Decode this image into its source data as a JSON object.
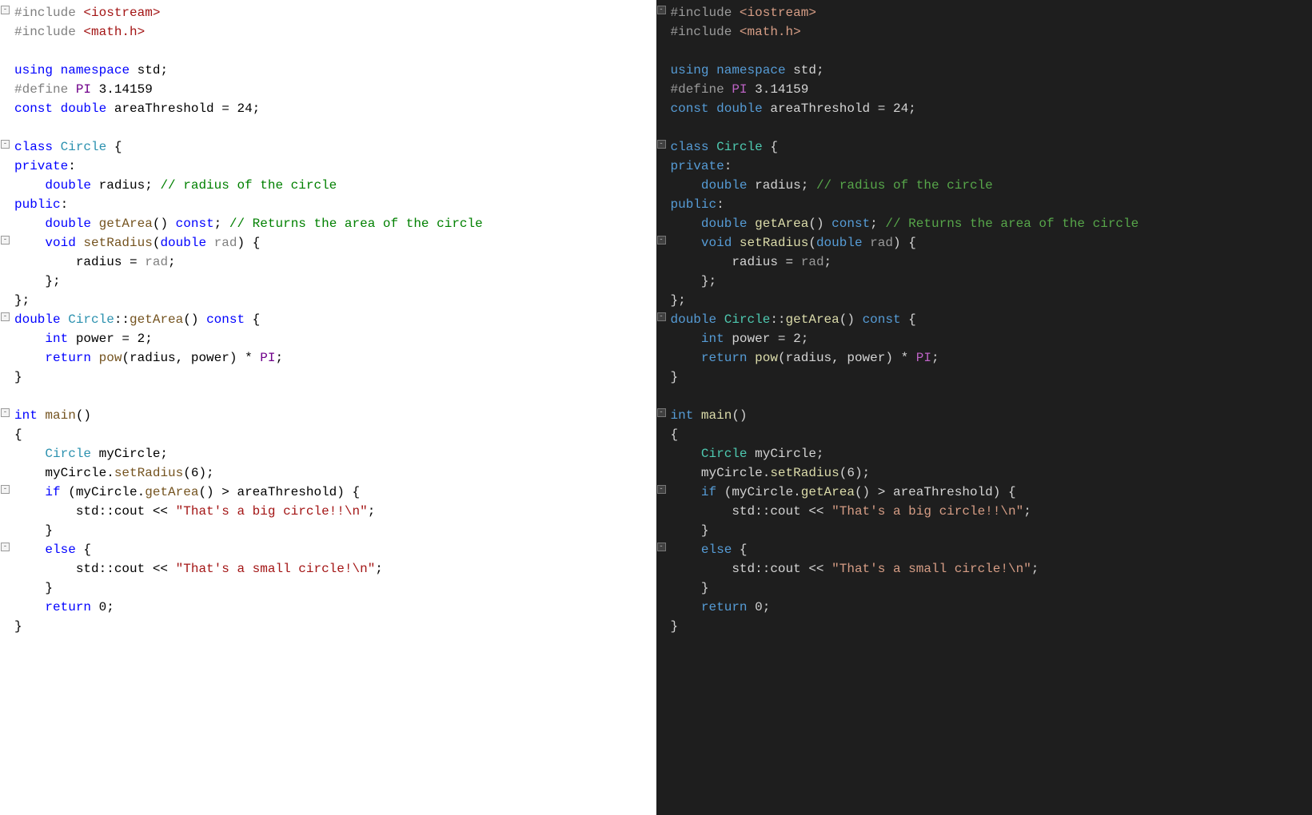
{
  "code": {
    "lines": [
      {
        "fold": "-",
        "tokens": [
          {
            "c": "pre",
            "t": "#include "
          },
          {
            "c": "inc",
            "t": "<iostream>"
          }
        ]
      },
      {
        "tokens": [
          {
            "c": "pre",
            "t": "#include "
          },
          {
            "c": "inc",
            "t": "<math.h>"
          }
        ]
      },
      {
        "tokens": []
      },
      {
        "tokens": [
          {
            "c": "kw",
            "t": "using"
          },
          {
            "c": "txt",
            "t": " "
          },
          {
            "c": "kw",
            "t": "namespace"
          },
          {
            "c": "txt",
            "t": " std;"
          }
        ]
      },
      {
        "tokens": [
          {
            "c": "pre",
            "t": "#define "
          },
          {
            "c": "macro",
            "t": "PI"
          },
          {
            "c": "txt",
            "t": " 3.14159"
          }
        ]
      },
      {
        "tokens": [
          {
            "c": "kw",
            "t": "const"
          },
          {
            "c": "txt",
            "t": " "
          },
          {
            "c": "kw",
            "t": "double"
          },
          {
            "c": "txt",
            "t": " areaThreshold = 24;"
          }
        ]
      },
      {
        "tokens": []
      },
      {
        "fold": "-",
        "tokens": [
          {
            "c": "kw",
            "t": "class"
          },
          {
            "c": "txt",
            "t": " "
          },
          {
            "c": "type",
            "t": "Circle"
          },
          {
            "c": "txt",
            "t": " {"
          }
        ]
      },
      {
        "tokens": [
          {
            "c": "kw",
            "t": "private"
          },
          {
            "c": "txt",
            "t": ":"
          }
        ]
      },
      {
        "tokens": [
          {
            "c": "txt",
            "t": "    "
          },
          {
            "c": "kw",
            "t": "double"
          },
          {
            "c": "txt",
            "t": " radius; "
          },
          {
            "c": "cmt",
            "t": "// radius of the circle"
          }
        ]
      },
      {
        "tokens": [
          {
            "c": "kw",
            "t": "public"
          },
          {
            "c": "txt",
            "t": ":"
          }
        ]
      },
      {
        "tokens": [
          {
            "c": "txt",
            "t": "    "
          },
          {
            "c": "kw",
            "t": "double"
          },
          {
            "c": "txt",
            "t": " "
          },
          {
            "c": "fn",
            "t": "getArea"
          },
          {
            "c": "txt",
            "t": "() "
          },
          {
            "c": "kw",
            "t": "const"
          },
          {
            "c": "txt",
            "t": "; "
          },
          {
            "c": "cmt",
            "t": "// Returns the area of the circle"
          }
        ]
      },
      {
        "fold": "-",
        "tokens": [
          {
            "c": "txt",
            "t": "    "
          },
          {
            "c": "kw",
            "t": "void"
          },
          {
            "c": "txt",
            "t": " "
          },
          {
            "c": "fn",
            "t": "setRadius"
          },
          {
            "c": "txt",
            "t": "("
          },
          {
            "c": "kw",
            "t": "double"
          },
          {
            "c": "txt",
            "t": " "
          },
          {
            "c": "param",
            "t": "rad"
          },
          {
            "c": "txt",
            "t": ") {"
          }
        ]
      },
      {
        "tokens": [
          {
            "c": "txt",
            "t": "        radius = "
          },
          {
            "c": "param",
            "t": "rad"
          },
          {
            "c": "txt",
            "t": ";"
          }
        ]
      },
      {
        "tokens": [
          {
            "c": "txt",
            "t": "    };"
          }
        ]
      },
      {
        "tokens": [
          {
            "c": "txt",
            "t": "};"
          }
        ]
      },
      {
        "fold": "-",
        "tokens": [
          {
            "c": "kw",
            "t": "double"
          },
          {
            "c": "txt",
            "t": " "
          },
          {
            "c": "type",
            "t": "Circle"
          },
          {
            "c": "txt",
            "t": "::"
          },
          {
            "c": "fn",
            "t": "getArea"
          },
          {
            "c": "txt",
            "t": "() "
          },
          {
            "c": "kw",
            "t": "const"
          },
          {
            "c": "txt",
            "t": " {"
          }
        ]
      },
      {
        "tokens": [
          {
            "c": "txt",
            "t": "    "
          },
          {
            "c": "kw",
            "t": "int"
          },
          {
            "c": "txt",
            "t": " power = 2;"
          }
        ]
      },
      {
        "tokens": [
          {
            "c": "txt",
            "t": "    "
          },
          {
            "c": "kw",
            "t": "return"
          },
          {
            "c": "txt",
            "t": " "
          },
          {
            "c": "fn",
            "t": "pow"
          },
          {
            "c": "txt",
            "t": "(radius, power) * "
          },
          {
            "c": "macro",
            "t": "PI"
          },
          {
            "c": "txt",
            "t": ";"
          }
        ]
      },
      {
        "tokens": [
          {
            "c": "txt",
            "t": "}"
          }
        ]
      },
      {
        "tokens": []
      },
      {
        "fold": "-",
        "tokens": [
          {
            "c": "kw",
            "t": "int"
          },
          {
            "c": "txt",
            "t": " "
          },
          {
            "c": "fn",
            "t": "main"
          },
          {
            "c": "txt",
            "t": "()"
          }
        ]
      },
      {
        "tokens": [
          {
            "c": "txt",
            "t": "{"
          }
        ]
      },
      {
        "tokens": [
          {
            "c": "txt",
            "t": "    "
          },
          {
            "c": "type",
            "t": "Circle"
          },
          {
            "c": "txt",
            "t": " myCircle;"
          }
        ]
      },
      {
        "tokens": [
          {
            "c": "txt",
            "t": "    myCircle."
          },
          {
            "c": "fn",
            "t": "setRadius"
          },
          {
            "c": "txt",
            "t": "(6);"
          }
        ]
      },
      {
        "fold": "-",
        "tokens": [
          {
            "c": "txt",
            "t": "    "
          },
          {
            "c": "kw",
            "t": "if"
          },
          {
            "c": "txt",
            "t": " (myCircle."
          },
          {
            "c": "fn",
            "t": "getArea"
          },
          {
            "c": "txt",
            "t": "() > areaThreshold) {"
          }
        ]
      },
      {
        "tokens": [
          {
            "c": "txt",
            "t": "        std::cout << "
          },
          {
            "c": "str",
            "t": "\"That's a big circle!!"
          },
          {
            "c": "esc",
            "t": "\\n"
          },
          {
            "c": "str",
            "t": "\""
          },
          {
            "c": "txt",
            "t": ";"
          }
        ]
      },
      {
        "tokens": [
          {
            "c": "txt",
            "t": "    }"
          }
        ]
      },
      {
        "fold": "-",
        "tokens": [
          {
            "c": "txt",
            "t": "    "
          },
          {
            "c": "kw",
            "t": "else"
          },
          {
            "c": "txt",
            "t": " {"
          }
        ]
      },
      {
        "tokens": [
          {
            "c": "txt",
            "t": "        std::cout << "
          },
          {
            "c": "str",
            "t": "\"That's a small circle!"
          },
          {
            "c": "esc",
            "t": "\\n"
          },
          {
            "c": "str",
            "t": "\""
          },
          {
            "c": "txt",
            "t": ";"
          }
        ]
      },
      {
        "tokens": [
          {
            "c": "txt",
            "t": "    }"
          }
        ]
      },
      {
        "tokens": [
          {
            "c": "txt",
            "t": "    "
          },
          {
            "c": "kw",
            "t": "return"
          },
          {
            "c": "txt",
            "t": " 0;"
          }
        ]
      },
      {
        "tokens": [
          {
            "c": "txt",
            "t": "}"
          }
        ]
      }
    ]
  },
  "themes": {
    "light": {
      "bg": "#ffffff"
    },
    "dark": {
      "bg": "#1e1e1e"
    }
  }
}
